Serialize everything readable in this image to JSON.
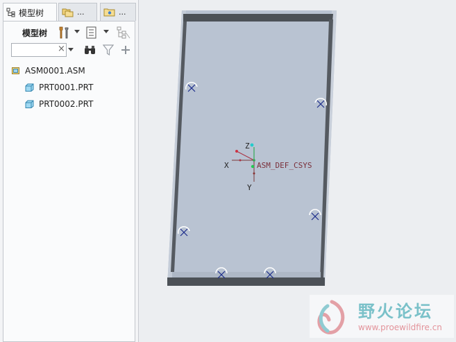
{
  "tabs": [
    {
      "label": "模型树",
      "icon": "model-tree-icon"
    },
    {
      "label": "...",
      "icon": "folder-browser-icon"
    },
    {
      "label": "...",
      "icon": "favorites-folder-icon"
    }
  ],
  "toolbar": {
    "model_tree_label": "模型树",
    "settings_icon": "tools-icon",
    "show_icon": "show-list-icon",
    "filter_display_icon": "column-display-icon"
  },
  "search": {
    "value": "",
    "clear_glyph": "×"
  },
  "tree": {
    "root": {
      "label": "ASM0001.ASM",
      "icon": "assembly-icon"
    },
    "children": [
      {
        "label": "PRT0001.PRT",
        "icon": "part-icon"
      },
      {
        "label": "PRT0002.PRT",
        "icon": "part-icon"
      }
    ]
  },
  "viewport": {
    "csys_label": "ASM_DEF_CSYS",
    "axis_x": "X",
    "axis_y": "Y",
    "axis_z": "Z",
    "plate_color": "#b9c3d2",
    "edge_color": "#555a61"
  },
  "watermark": {
    "title": "野火论坛",
    "url": "www.proewildfire.cn"
  }
}
